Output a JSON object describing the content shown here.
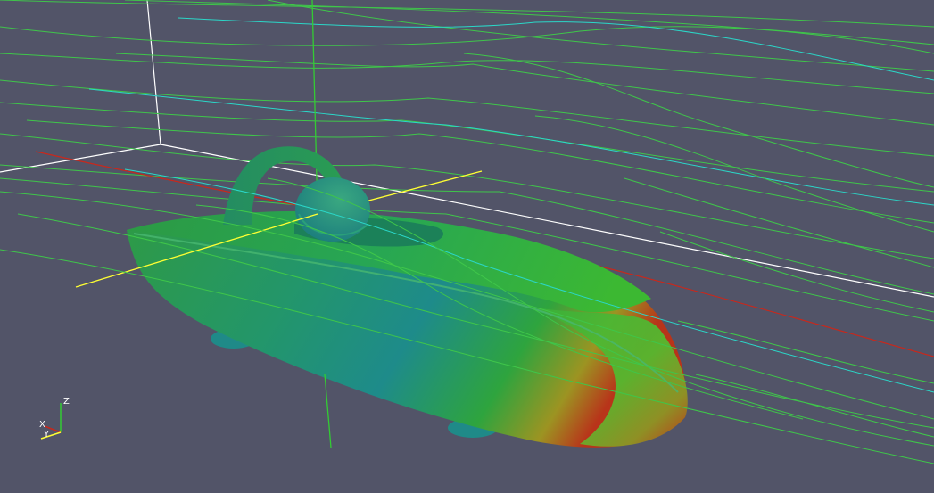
{
  "scene": {
    "background_color": "#525468",
    "model": "car-body",
    "colormap": [
      "#1e8a96",
      "#1fa07a",
      "#2cb04a",
      "#4cc030",
      "#d09020",
      "#c83018"
    ],
    "streamline_colors": [
      "#3fc64a",
      "#2bd7c8",
      "#1fb76e",
      "#c8281c"
    ],
    "bounding_box_color": "#ffffff",
    "axes_colors": {
      "x": "#ffff33",
      "y": "#33cc33",
      "z": "#33cc33"
    }
  },
  "orientation_axes": {
    "z_label": "Z",
    "x_label": "X",
    "y_label": "Y"
  }
}
